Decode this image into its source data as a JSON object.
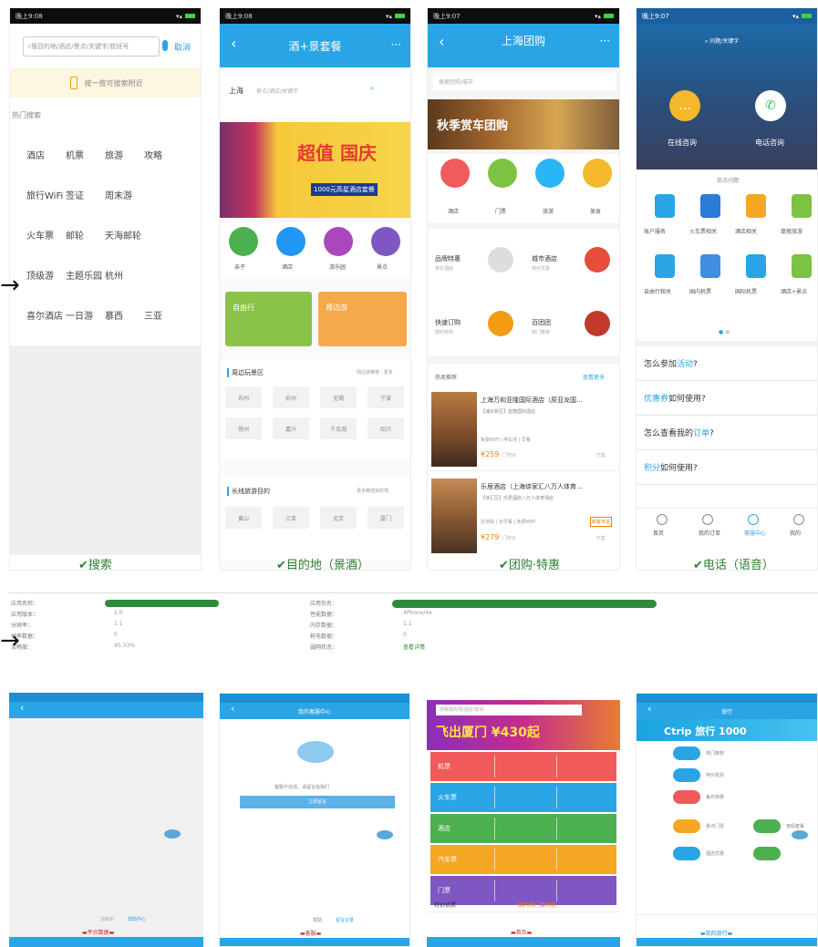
{
  "p1": {
    "status_time": "晚上9:08",
    "search_placeholder": "搜目的地/酒店/景点/关键字/航班号",
    "cancel": "取消",
    "voice_hint": "按一按可搜索附近",
    "hot_title": "热门搜索",
    "rows": [
      [
        "酒店",
        "机票",
        "旅游",
        "攻略"
      ],
      [
        "旅行WiFi",
        "签证",
        "周末游"
      ],
      [
        "火车票",
        "邮轮",
        "天海邮轮"
      ],
      [
        "顶级游",
        "主题乐园",
        "杭州"
      ],
      [
        "喜尔酒店",
        "一日游",
        "慕西",
        "三亚"
      ]
    ],
    "caption": "✔搜索"
  },
  "p2": {
    "status_time": "晚上9:08",
    "title": "酒+景套餐",
    "city": "上海",
    "input_placeholder": "景点/酒店/关键字",
    "banner_main": "超值 国庆",
    "banner_sub": "1000元高星酒店套餐",
    "icons": [
      "亲子",
      "酒店",
      "游乐园",
      "景点"
    ],
    "card1": "自由行",
    "card2": "周边游",
    "section1": "周边玩景区",
    "section1_more": "周边游推荐 · 更多",
    "grid1": [
      "苏州",
      "杭州",
      "无锡",
      "宁波",
      "常州",
      "嘉兴",
      "千岛湖",
      "绍兴"
    ],
    "section2": "长线旅游目的",
    "section2_more": "更多精选目的地",
    "grid2": [
      "黄山",
      "三亚",
      "北京",
      "厦门"
    ],
    "caption": "✔目的地（景酒）"
  },
  "p3": {
    "status_time": "晚上9:07",
    "title": "上海团购",
    "search_placeholder": "搜索团购/城市",
    "banner_text": "秋季赏车团购",
    "icons": [
      "酒店",
      "门票",
      "旅游",
      "美食"
    ],
    "promo": [
      {
        "t": "品牌特惠",
        "s": "特价酒店"
      },
      {
        "t": "城市酒店",
        "s": "特价优惠"
      },
      {
        "t": "快速订购",
        "s": "限时抢购"
      },
      {
        "t": "百团团",
        "s": "热门推荐"
      }
    ],
    "section": "热卖推荐",
    "more": "查看更多",
    "hotel1": {
      "name": "上海万和亚隆国际酒店（原亚龙国...",
      "sub": "【浦东新区】亚隆国际酒店",
      "tags": "免费WiFi | 停车场 | 早餐",
      "price": "¥259",
      "orig": "门市价",
      "sold": "已售"
    },
    "hotel2": {
      "name": "乐居酒店（上海徐家汇八万人体育...",
      "sub": "【徐汇区】乐居酒店八万人体育场店",
      "tags": "近地铁 | 含早餐 | 免费WiFi",
      "price": "¥279",
      "orig": "门市价",
      "sold": "已售",
      "badge": "新客专享"
    },
    "caption": "✔团购·特惠"
  },
  "p4": {
    "status_time": "晚上9:07",
    "search_placeholder": "问题/关键字",
    "btn_online": "在线咨询",
    "btn_phone": "电话咨询",
    "hot_title": "热点问题",
    "icons": [
      "账户服务",
      "火车票相关",
      "酒店相关",
      "度假旅游",
      "自由行相关",
      "国内机票",
      "国际机票",
      "酒店+景点"
    ],
    "faqs": [
      "怎么参加#活动#?",
      "#优惠券#如何使用?",
      "怎么查看我的#订单#?",
      "#积分#如何使用?"
    ],
    "tabbar": [
      "首页",
      "我的订单",
      "客服中心",
      "我的"
    ],
    "caption": "✔电话（语音）"
  },
  "details": {
    "left_labels": [
      "应用名称：",
      "应用版本：",
      "分辨率：",
      "帧率数据：",
      "流畅度："
    ],
    "left_values": [
      "",
      "2.0",
      "1.1",
      "0",
      "95.33%"
    ],
    "right_labels": [
      "应用包名：",
      "性能数据：",
      "内存数据：",
      "耗电数据：",
      "弱网状态："
    ],
    "right_values": [
      "",
      "4Phone/4x",
      "1.1",
      "0",
      "查看详情"
    ]
  },
  "b1": {
    "hint": "加载中",
    "link": "帮助中心",
    "caption": "▬平台数据▬"
  },
  "b2": {
    "title": "我的客服中心",
    "msg": "客服不在线，请留言给我们",
    "button": "立即留言",
    "link1": "帮助",
    "link2": "留言记录",
    "caption": "▬客服▬"
  },
  "b3": {
    "search_placeholder": "搜索目的地/酒店/景点",
    "banner": "飞出厦门 ¥430起",
    "rows": [
      "机票",
      "火车票",
      "酒店",
      "汽车票",
      "门票"
    ],
    "footer1": "特价机票",
    "footer2": "国内热门目的地",
    "caption": "▬首页▬"
  },
  "b4": {
    "title": "旅行",
    "banner": "Ctrip 旅行 1000",
    "items": [
      "热门推荐",
      "特价机票",
      "每日特惠",
      "景点门票",
      "度假套餐",
      "酒店优惠"
    ],
    "caption": "▬我的旅行▬"
  },
  "colors": {
    "blue": "#29a5e6",
    "green": "#2e7d32",
    "yellow": "#f5c21b",
    "bar_green": "#2e8b3c"
  }
}
